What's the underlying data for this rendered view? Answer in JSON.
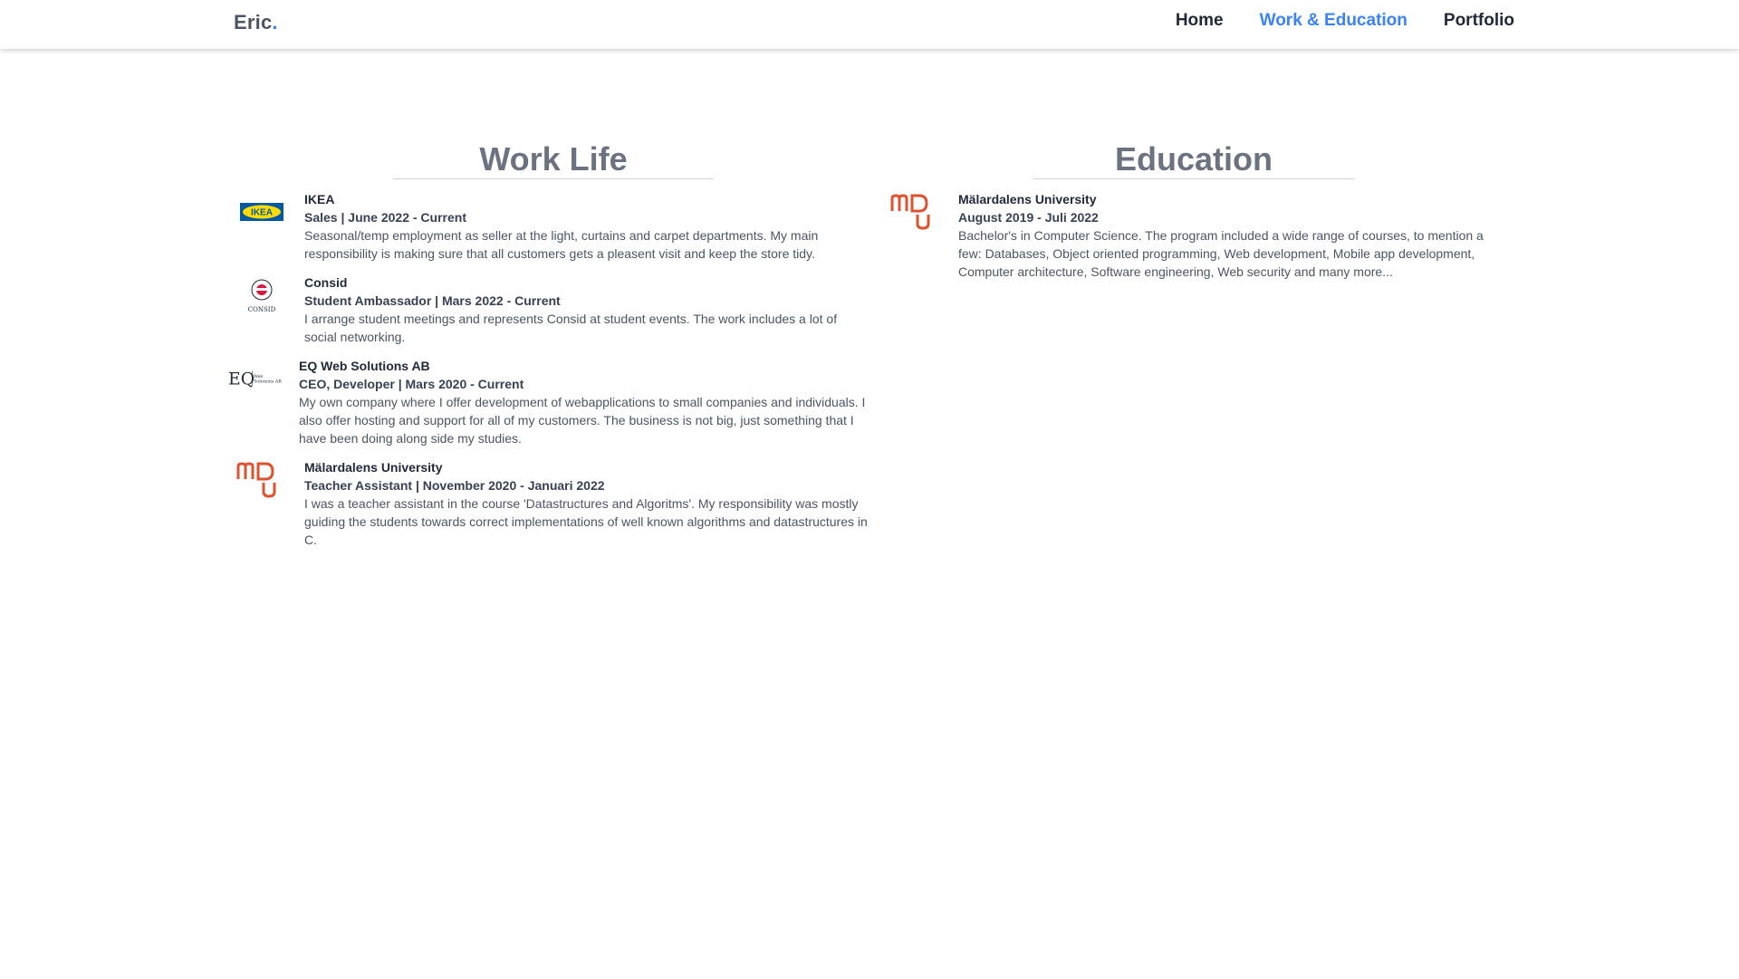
{
  "brand": {
    "name": "Eric",
    "dot": "."
  },
  "nav": {
    "items": [
      {
        "label": "Home",
        "active": false
      },
      {
        "label": "Work & Education",
        "active": true
      },
      {
        "label": "Portfolio",
        "active": false
      }
    ]
  },
  "colors": {
    "accent": "#3b82f6",
    "heading": "#6b7280",
    "mdu_red": "#e0522f",
    "ikea_blue": "#0058a3",
    "ikea_yellow": "#ffdb00",
    "consid_red": "#d7193f"
  },
  "work": {
    "title": "Work Life",
    "entries": [
      {
        "logo": "ikea-logo",
        "company": "IKEA",
        "role": "Sales | June 2022 - Current",
        "description": "Seasonal/temp employment as seller at the light, curtains and carpet departments. My main responsibility is making sure that all customers gets a pleasent visit and keep the store tidy."
      },
      {
        "logo": "consid-logo",
        "company": "Consid",
        "role": "Student Ambassador | Mars 2022 - Current",
        "description": "I arrange student meetings and represents Consid at student events. The work includes a lot of social networking."
      },
      {
        "logo": "eq-web-solutions-logo",
        "company": "EQ Web Solutions AB",
        "role": "CEO, Developer | Mars 2020 - Current",
        "description": "My own company where I offer development of webapplications to small companies and individuals. I also offer hosting and support for all of my customers. The business is not big, just something that I have been doing along side my studies."
      },
      {
        "logo": "mdu-logo",
        "company": "Mälardalens University",
        "role": "Teacher Assistant | November 2020 - Januari 2022",
        "description": "I was a teacher assistant in the course 'Datastructures and Algoritms'. My responsibility was mostly guiding the students towards correct implementations of well known algorithms and datastructures in C."
      }
    ]
  },
  "education": {
    "title": "Education",
    "entries": [
      {
        "logo": "mdu-logo",
        "company": "Mälardalens University",
        "role": "August 2019 - Juli 2022",
        "description": "Bachelor's in Computer Science. The program included a wide range of courses, to mention a few: Databases, Object oriented programming, Web development, Mobile app development, Computer architecture, Software engineering, Web security and many more..."
      }
    ]
  },
  "logos": {
    "ikea_text": "IKEA",
    "consid_text": "CONSID",
    "eq_text": "EQ",
    "eq_sub": "Web Solutions AB"
  }
}
